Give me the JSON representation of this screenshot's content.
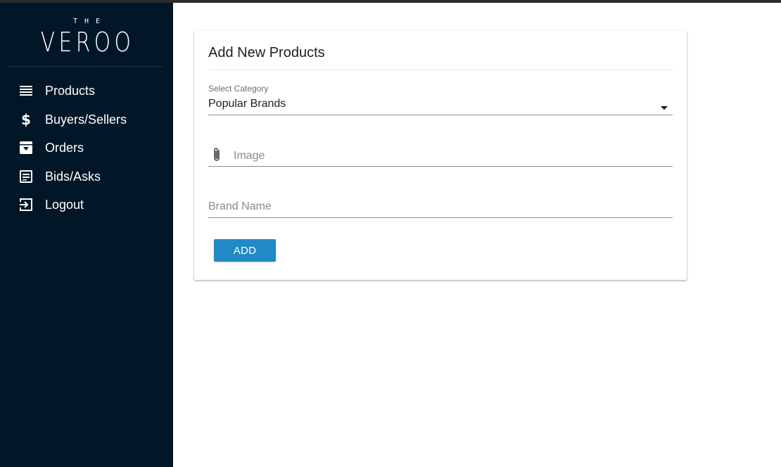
{
  "brand": {
    "small": "THE",
    "name": "VEROO"
  },
  "sidebar": {
    "items": [
      {
        "label": "Products",
        "icon": "list-icon"
      },
      {
        "label": "Buyers/Sellers",
        "icon": "dollar-icon"
      },
      {
        "label": "Orders",
        "icon": "archive-icon"
      },
      {
        "label": "Bids/Asks",
        "icon": "document-icon"
      },
      {
        "label": "Logout",
        "icon": "logout-icon"
      }
    ]
  },
  "form": {
    "title": "Add New Products",
    "category": {
      "label": "Select Category",
      "value": "Popular Brands"
    },
    "image": {
      "placeholder": "Image",
      "icon": "paperclip-icon"
    },
    "brand_name": {
      "placeholder": "Brand Name",
      "value": ""
    },
    "add_label": "ADD"
  },
  "colors": {
    "sidebar_bg": "#011627",
    "accent": "#2189c6",
    "text": "#1e1e1e",
    "muted": "#8a8a8a"
  }
}
